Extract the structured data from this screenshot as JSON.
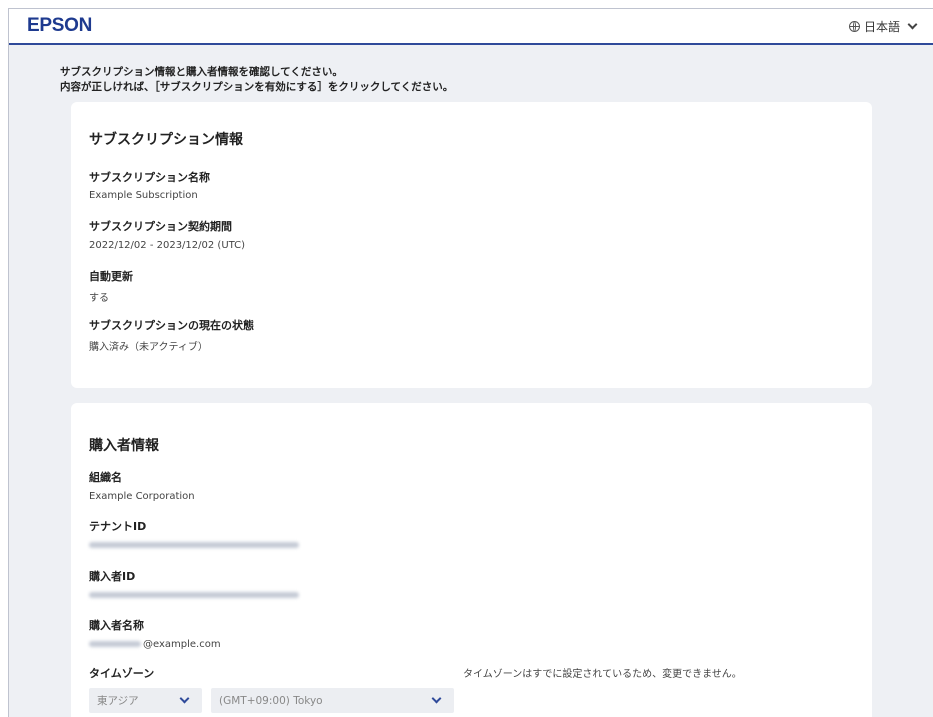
{
  "header": {
    "logo": "EPSON",
    "language": "日本語"
  },
  "intro": {
    "line1": "サブスクリプション情報と購入者情報を確認してください。",
    "line2": "内容が正しければ、［サブスクリプションを有効にする］をクリックしてください。"
  },
  "subscription": {
    "title": "サブスクリプション情報",
    "name_label": "サブスクリプション名称",
    "name_value": "Example Subscription",
    "period_label": "サブスクリプション契約期間",
    "period_value": "2022/12/02 - 2023/12/02 (UTC)",
    "auto_renew_label": "自動更新",
    "auto_renew_value": "する",
    "status_label": "サブスクリプションの現在の状態",
    "status_value": "購入済み（未アクティブ）"
  },
  "purchaser": {
    "title": "購入者情報",
    "org_label": "組織名",
    "org_value": "Example Corporation",
    "tenant_label": "テナントID",
    "purchaser_id_label": "購入者ID",
    "purchaser_name_label": "購入者名称",
    "purchaser_name_domain": "@example.com",
    "timezone_label": "タイムゾーン",
    "timezone_note": "タイムゾーンはすでに設定されているため、変更できません。",
    "region_value": "東アジア",
    "zone_value": "(GMT+09:00) Tokyo"
  }
}
